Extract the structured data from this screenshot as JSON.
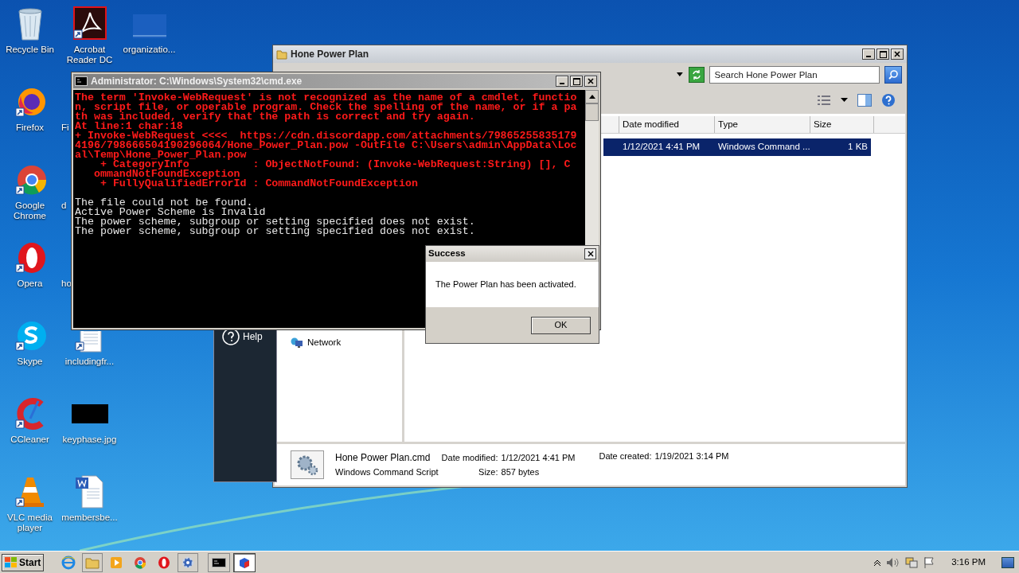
{
  "desktop": {
    "columns": [
      {
        "icons": [
          {
            "label": "Recycle Bin",
            "hidden_behind_window": false
          },
          {
            "label": "Firefox",
            "hidden_behind_window": false
          },
          {
            "label": "Google Chrome",
            "hidden_behind_window": false
          },
          {
            "label": "Opera",
            "hidden_behind_window": false
          },
          {
            "label": "Skype",
            "hidden_behind_window": false
          },
          {
            "label": "CCleaner",
            "hidden_behind_window": false
          },
          {
            "label": "VLC media player",
            "hidden_behind_window": false
          }
        ]
      },
      {
        "icons": [
          {
            "label": "Acrobat Reader DC",
            "hidden_behind_window": false
          },
          {
            "label": "Fi",
            "hidden_behind_window": true
          },
          {
            "label": "d",
            "hidden_behind_window": true
          },
          {
            "label": "ho",
            "hidden_behind_window": true
          },
          {
            "label": "includingfr...",
            "hidden_behind_window": false
          },
          {
            "label": "keyphase.jpg",
            "hidden_behind_window": false
          },
          {
            "label": "membersbe...",
            "hidden_behind_window": false
          }
        ]
      },
      {
        "icons": [
          {
            "label": "organizatio...",
            "hidden_behind_window": false
          }
        ]
      }
    ]
  },
  "explorer": {
    "title": "Hone Power Plan",
    "search": {
      "placeholder": "Search Hone Power Plan"
    },
    "columns": [
      "Date modified",
      "Type",
      "Size"
    ],
    "rows": [
      {
        "date_modified": "1/12/2021 4:41 PM",
        "type": "Windows Command ...",
        "size": "1 KB",
        "selected": true
      }
    ],
    "nav_items": [
      "Network"
    ],
    "details": {
      "name": "Hone Power Plan.cmd",
      "type": "Windows Command Script",
      "properties": [
        {
          "label": "Date modified:",
          "value": "1/12/2021 4:41 PM"
        },
        {
          "label": "Size:",
          "value": "857 bytes"
        },
        {
          "label": "Date created:",
          "value": "1/19/2021 3:14 PM"
        }
      ]
    }
  },
  "background_window": {
    "help_label": "Help"
  },
  "console": {
    "title": "Administrator: C:\\Windows\\System32\\cmd.exe",
    "error_lines": [
      "The term 'Invoke-WebRequest' is not recognized as the name of a cmdlet, functio",
      "n, script file, or operable program. Check the spelling of the name, or if a pa",
      "th was included, verify that the path is correct and try again.",
      "At line:1 char:18",
      "+ Invoke-WebRequest <<<<  https://cdn.discordapp.com/attachments/79865255835179",
      "4196/798666504190296064/Hone_Power_Plan.pow -OutFile C:\\Users\\admin\\AppData\\Loc",
      "al\\Temp\\Hone_Power_Plan.pow",
      "    + CategoryInfo          : ObjectNotFound: (Invoke-WebRequest:String) [], C",
      "   ommandNotFoundException",
      "    + FullyQualifiedErrorId : CommandNotFoundException"
    ],
    "output_lines": [
      "The file could not be found.",
      "Active Power Scheme is Invalid",
      "The power scheme, subgroup or setting specified does not exist.",
      "The power scheme, subgroup or setting specified does not exist."
    ]
  },
  "dialog": {
    "title": "Success",
    "message": "The Power Plan has been activated.",
    "button": "OK"
  },
  "taskbar": {
    "start": "Start",
    "clock": "3:16 PM"
  }
}
